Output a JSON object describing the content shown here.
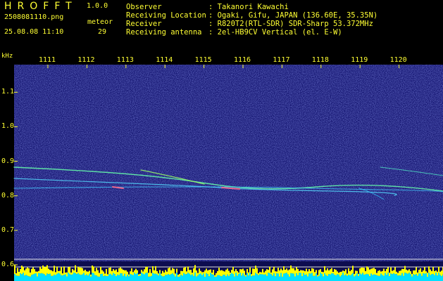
{
  "app": {
    "title": "HROFFT",
    "version": "1.0.0"
  },
  "file": {
    "name": "2508081110.png",
    "datetime": "25.08.08 11:10"
  },
  "meteor": {
    "label": "meteor",
    "count": "29"
  },
  "info": [
    {
      "label": "Observer",
      "value": ": Takanori Kawachi"
    },
    {
      "label": "Receiving Location",
      "value": ": Ogaki, Gifu, JAPAN (136.60E, 35.35N)"
    },
    {
      "label": "Receiver",
      "value": ": R820T2(RTL-SDR) SDR-Sharp 53.372MHz"
    },
    {
      "label": "Receiving antenna",
      "value": ": 2el-HB9CV Vertical (el. E-W)"
    }
  ],
  "chart_data": {
    "type": "heatmap",
    "ylabel": "kHz",
    "x_ticks": [
      "1111",
      "1112",
      "1113",
      "1114",
      "1115",
      "1116",
      "1117",
      "1118",
      "1119",
      "1120"
    ],
    "y_ticks": [
      "1.1",
      "1.0",
      "0.9",
      "0.8",
      "0.7",
      "0.6"
    ],
    "y_range": [
      0.6,
      1.18
    ],
    "colors": {
      "background": "#12126e",
      "text": "#ffff33",
      "signal": "#33ffcc",
      "bar_top": "#ffff00",
      "bar_base": "#00e0ff"
    }
  }
}
